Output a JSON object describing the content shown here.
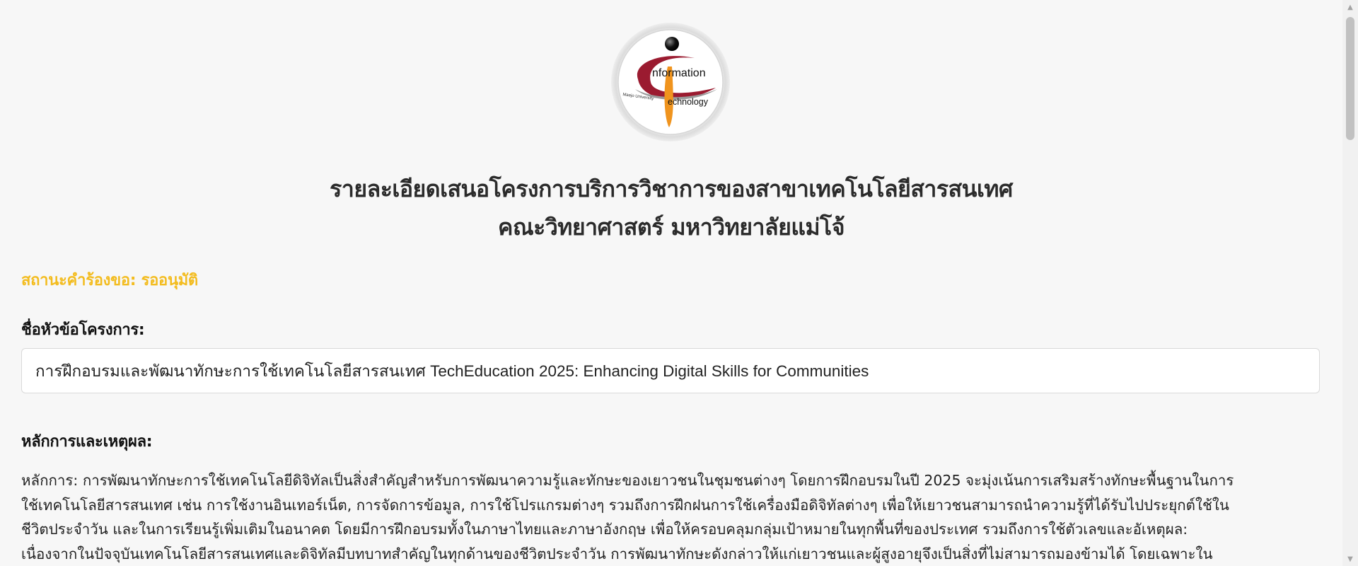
{
  "logo": {
    "text_top": "nformation",
    "text_bottom": "echnology",
    "text_small": "Maejo University",
    "colors": {
      "swoosh": "#9b1b30",
      "orange": "#f0941e",
      "ring": "#e9e9e9"
    }
  },
  "header": {
    "title_line1": "รายละเอียดเสนอโครงการบริการวิชาการของสาขาเทคโนโลยีสารสนเทศ",
    "title_line2": "คณะวิทยาศาสตร์ มหาวิทยาลัยแม่โจ้"
  },
  "status": {
    "label": "สถานะคำร้องขอ:",
    "value": "รออนุมัติ",
    "color": "#f3bc1f"
  },
  "topic": {
    "label": "ชื่อหัวข้อโครงการ:",
    "value": "การฝึกอบรมและพัฒนาทักษะการใช้เทคโนโลยีสารสนเทศ TechEducation 2025: Enhancing Digital Skills for Communities"
  },
  "rationale": {
    "label": "หลักการและเหตุผล:",
    "lines": [
      "หลักการ: การพัฒนาทักษะการใช้เทคโนโลยีดิจิทัลเป็นสิ่งสำคัญสำหรับการพัฒนาความรู้และทักษะของเยาวชนในชุมชนต่างๆ โดยการฝึกอบรมในปี 2025 จะมุ่งเน้นการเสริมสร้างทักษะพื้นฐานในการ",
      "ใช้เทคโนโลยีสารสนเทศ เช่น การใช้งานอินเทอร์เน็ต, การจัดการข้อมูล, การใช้โปรแกรมต่างๆ รวมถึงการฝึกฝนการใช้เครื่องมือดิจิทัลต่างๆ เพื่อให้เยาวชนสามารถนำความรู้ที่ได้รับไปประยุกต์ใช้ใน",
      "ชีวิตประจำวัน และในการเรียนรู้เพิ่มเติมในอนาคต โดยมีการฝึกอบรมทั้งในภาษาไทยและภาษาอังกฤษ เพื่อให้ครอบคลุมกลุ่มเป้าหมายในทุกพื้นที่ของประเทศ รวมถึงการใช้ตัวเลขและอัเหตุผล:",
      "เนื่องจากในปัจจุบันเทคโนโลยีสารสนเทศและดิจิทัลมีบทบาทสำคัญในทุกด้านของชีวิตประจำวัน การพัฒนาทักษะดังกล่าวให้แก่เยาวชนและผู้สูงอายุจึงเป็นสิ่งที่ไม่สามารถมองข้ามได้ โดยเฉพาะใน"
    ]
  },
  "scrollbar": {
    "up_icon": "▲",
    "down_icon": "▼"
  }
}
